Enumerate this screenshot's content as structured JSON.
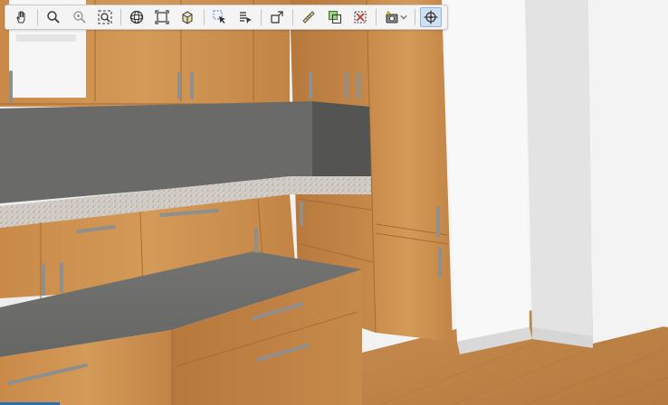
{
  "viewport": {
    "colors": {
      "wall": "#ededee",
      "floor": "#c68a4d",
      "wood": "#c98f4f",
      "countertop_grey": "#6f706d",
      "backsplash": "#5e5f5c",
      "granite": "#cfcac4",
      "handle": "#8a8a88"
    }
  },
  "toolbar": {
    "buttons": [
      {
        "id": "pan",
        "icon": "hand-icon"
      },
      {
        "id": "zoom",
        "icon": "zoom-in-icon"
      },
      {
        "id": "zoom-region",
        "icon": "zoom-region-icon"
      },
      {
        "id": "zoom-fit",
        "icon": "zoom-extents-icon"
      },
      {
        "id": "orbit",
        "icon": "orbit-icon"
      },
      {
        "id": "view-front",
        "icon": "view-front-icon"
      },
      {
        "id": "view-3d",
        "icon": "view-box-icon"
      },
      {
        "id": "select",
        "icon": "select-cursor-icon"
      },
      {
        "id": "select-list",
        "icon": "select-list-icon"
      },
      {
        "id": "dimension",
        "icon": "dimension-icon"
      },
      {
        "id": "measure",
        "icon": "ruler-icon"
      },
      {
        "id": "insert",
        "icon": "insert-object-icon"
      },
      {
        "id": "delete",
        "icon": "delete-object-icon"
      },
      {
        "id": "render",
        "icon": "camera-flash-icon"
      },
      {
        "id": "navigate",
        "icon": "crosshair-icon",
        "active": true
      }
    ]
  }
}
